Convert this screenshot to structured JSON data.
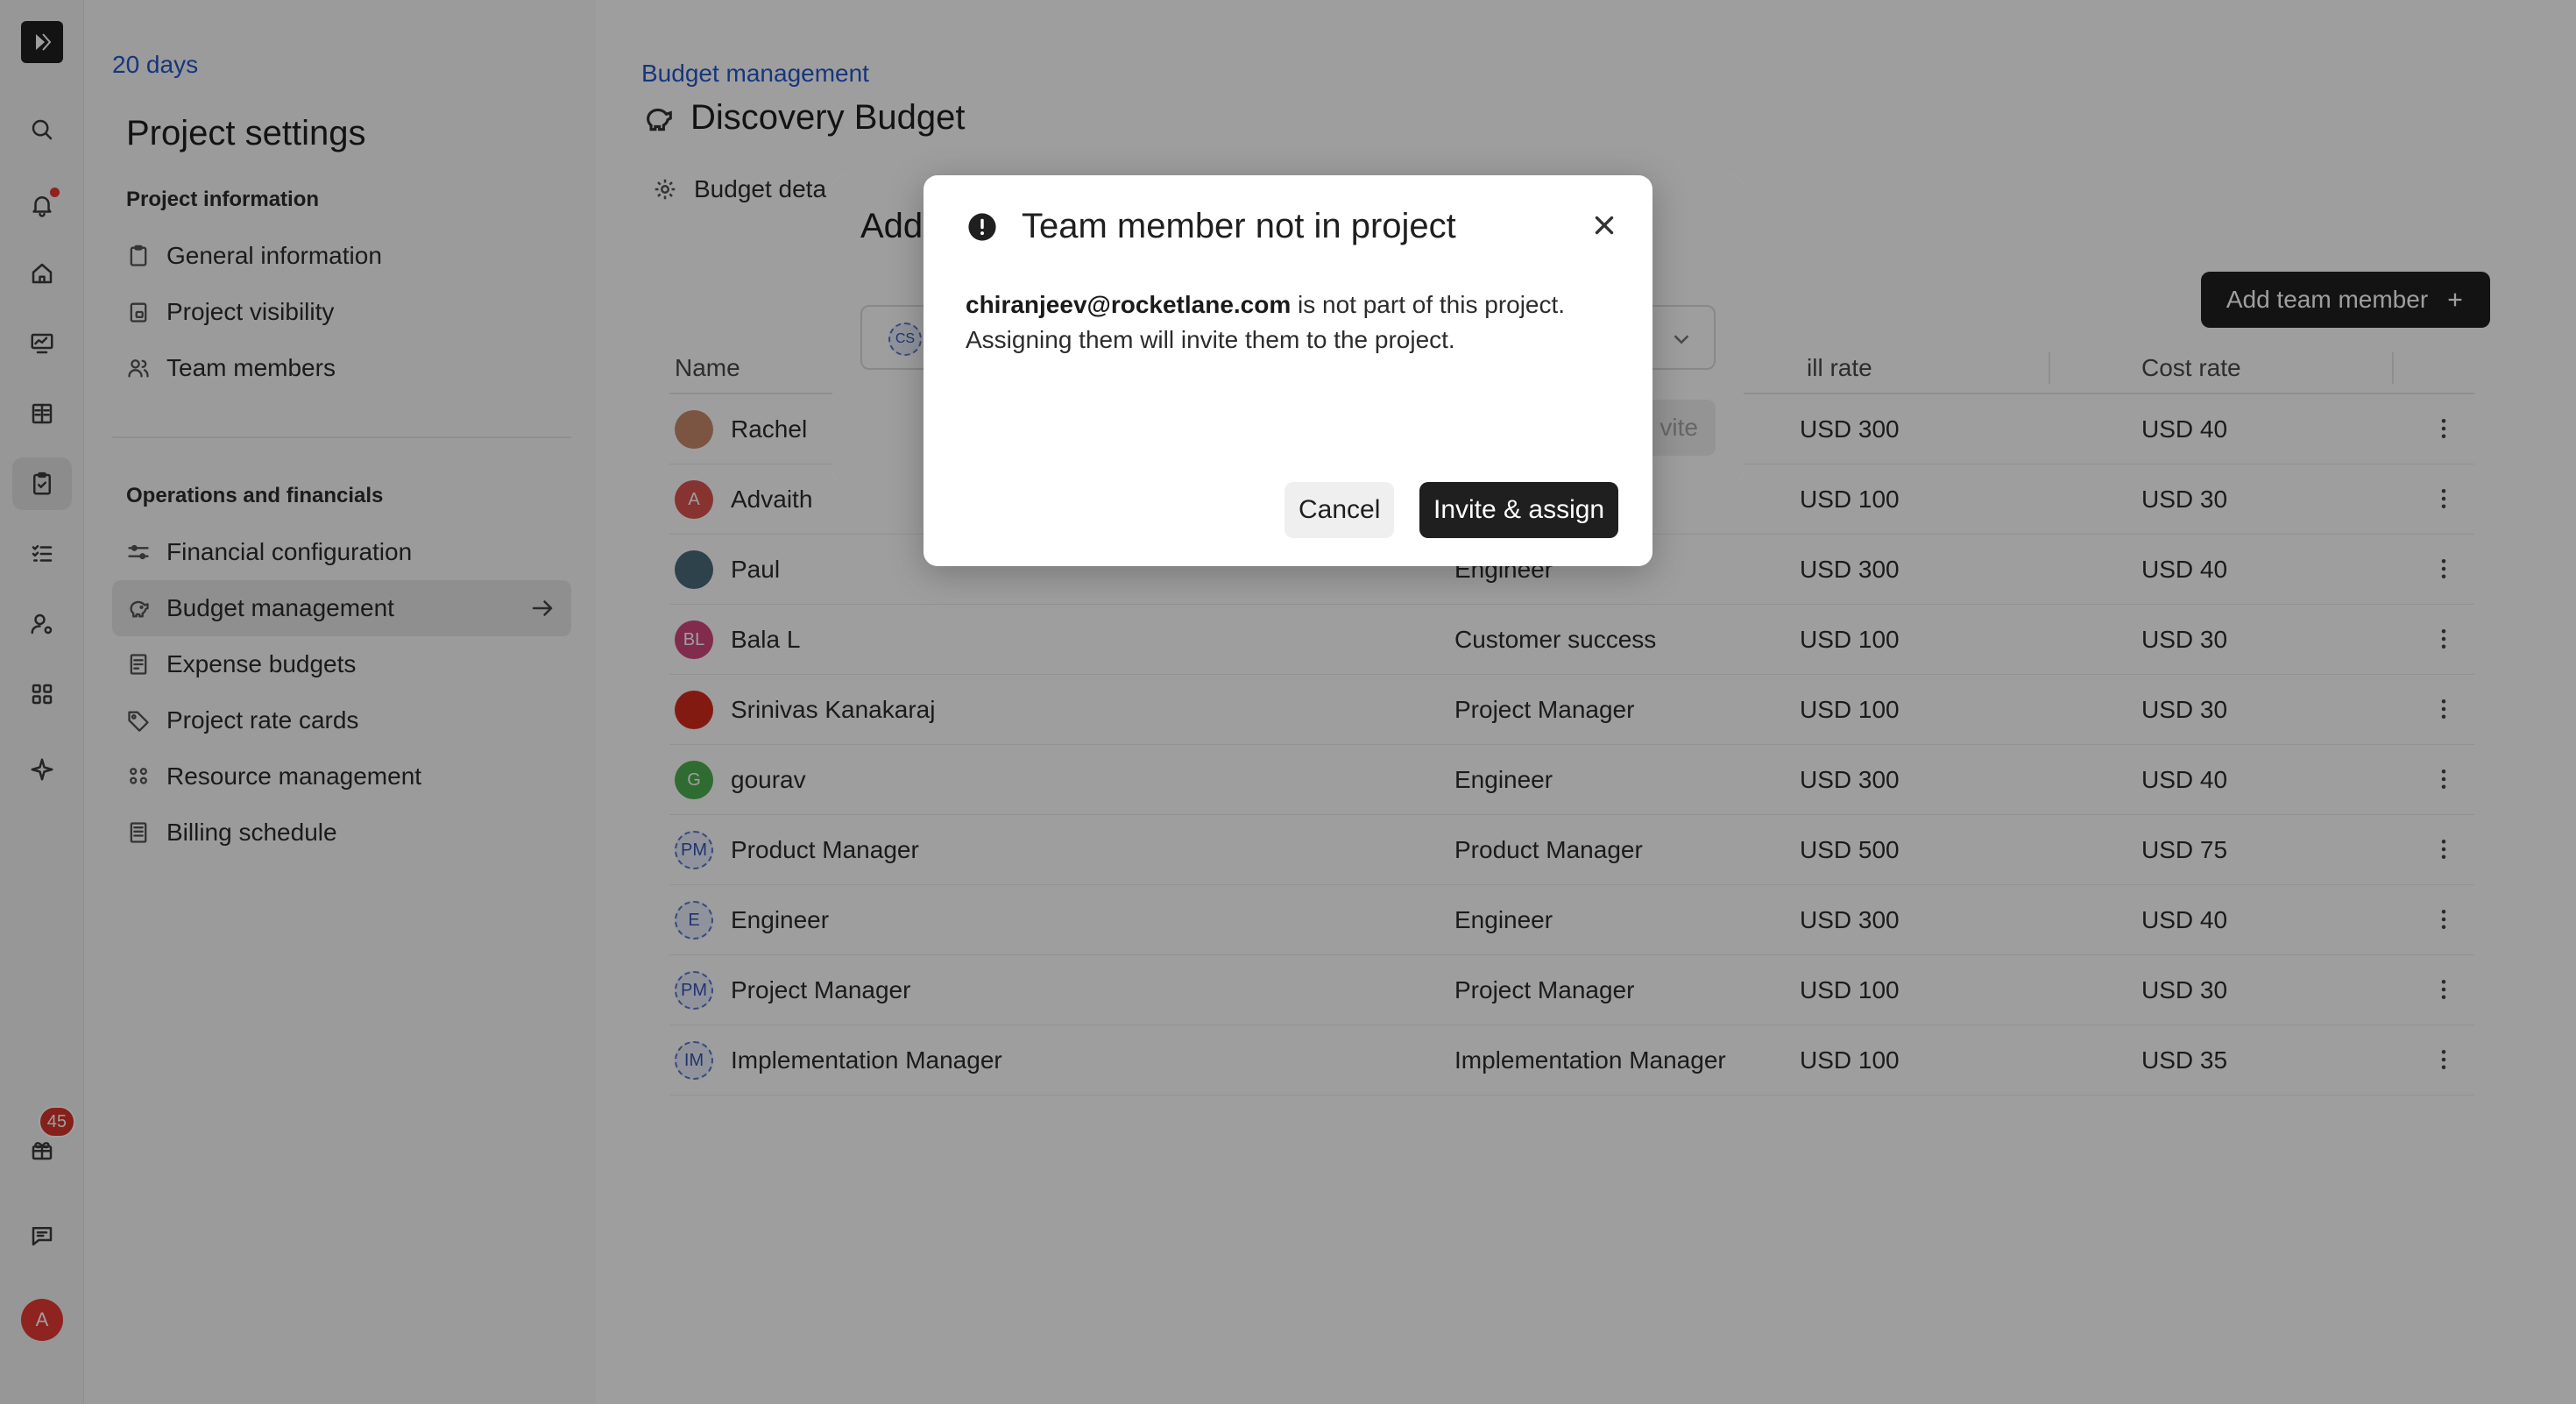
{
  "rail": {
    "items": [
      {
        "name": "search-icon"
      },
      {
        "name": "bell-icon"
      },
      {
        "name": "home-icon"
      },
      {
        "name": "monitor-icon"
      },
      {
        "name": "book-icon"
      },
      {
        "name": "clipboard-icon"
      },
      {
        "name": "checklist-icon"
      },
      {
        "name": "user-settings-icon"
      },
      {
        "name": "apps-icon"
      },
      {
        "name": "sparkle-icon"
      },
      {
        "name": "gift-icon"
      },
      {
        "name": "chat-icon"
      }
    ],
    "gift_badge": "45",
    "avatar_initial": "A"
  },
  "settings": {
    "back_label": "20 days",
    "title": "Project settings",
    "section_project_info": "Project information",
    "general_information": "General information",
    "project_visibility": "Project visibility",
    "team_members": "Team members",
    "section_operations": "Operations and financials",
    "financial_configuration": "Financial configuration",
    "budget_management": "Budget management",
    "expense_budgets": "Expense budgets",
    "project_rate_cards": "Project rate cards",
    "resource_management": "Resource management",
    "billing_schedule": "Billing schedule"
  },
  "main": {
    "breadcrumb": "Budget management",
    "title": "Discovery Budget",
    "tab_label": "Budget deta",
    "add_button": "Add team member",
    "table": {
      "col_name": "Name",
      "col_bill_rate": "ill rate",
      "col_cost_rate": "Cost rate",
      "rows": [
        {
          "name": "Rachel",
          "initials": "",
          "avatar_color": "#c98a6b",
          "role": "",
          "bill": "USD 300",
          "cost": "USD 40"
        },
        {
          "name": "Advaith",
          "initials": "A",
          "avatar_color": "#d9534f",
          "role": "",
          "bill": "USD 100",
          "cost": "USD 30"
        },
        {
          "name": "Paul",
          "initials": "",
          "avatar_color": "#4a6b7a",
          "role": "Engineer",
          "bill": "USD 300",
          "cost": "USD 40"
        },
        {
          "name": "Bala L",
          "initials": "BL",
          "avatar_color": "#d0467d",
          "role": "Customer success",
          "bill": "USD 100",
          "cost": "USD 30"
        },
        {
          "name": "Srinivas Kanakaraj",
          "initials": "",
          "avatar_color": "#d42a1e",
          "role": "Project Manager",
          "bill": "USD 100",
          "cost": "USD 30"
        },
        {
          "name": "gourav",
          "initials": "G",
          "avatar_color": "#4caf50",
          "role": "Engineer",
          "bill": "USD 300",
          "cost": "USD 40"
        },
        {
          "name": "Product Manager",
          "initials": "PM",
          "avatar_color": "dashed",
          "role": "Product Manager",
          "bill": "USD 500",
          "cost": "USD 75"
        },
        {
          "name": "Engineer",
          "initials": "E",
          "avatar_color": "dashed",
          "role": "Engineer",
          "bill": "USD 300",
          "cost": "USD 40"
        },
        {
          "name": "Project Manager",
          "initials": "PM",
          "avatar_color": "dashed",
          "role": "Project Manager",
          "bill": "USD 100",
          "cost": "USD 30"
        },
        {
          "name": "Implementation Manager",
          "initials": "IM",
          "avatar_color": "dashed",
          "role": "Implementation Manager",
          "bill": "USD 100",
          "cost": "USD 35"
        }
      ]
    }
  },
  "back_dialog": {
    "title": "Add",
    "chip": "CS",
    "button": "vite"
  },
  "modal": {
    "title": "Team member not in project",
    "email": "chiranjeev@rocketlane.com",
    "message_rest": " is not part of this project.",
    "message_line2": "Assigning them will invite them to the project.",
    "cancel": "Cancel",
    "confirm": "Invite & assign"
  }
}
